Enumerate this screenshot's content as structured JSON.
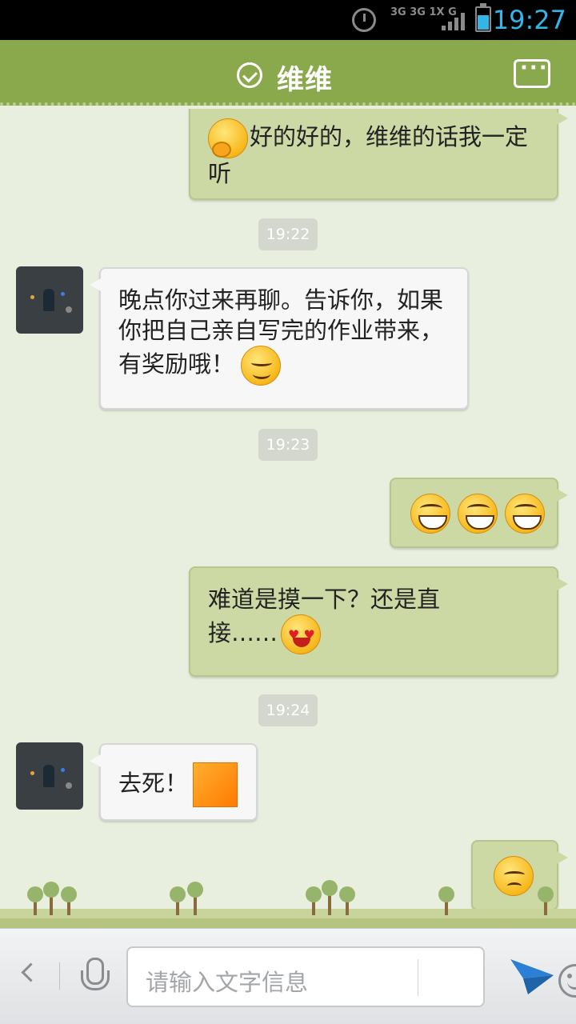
{
  "status_bar": {
    "time": "19:27",
    "network_label": "3G 3G 1X G",
    "alarm_icon": "alarm-icon",
    "signal_icon": "signal-bars-icon",
    "battery_icon": "battery-icon",
    "accent_color": "#33b5e5"
  },
  "header": {
    "title": "维维",
    "verified_icon": "check-circle-icon",
    "menu_icon": "more-dots-icon",
    "background_color": "#8aa94c"
  },
  "messages": [
    {
      "side": "me",
      "text": "好的好的，维维的话我一定听",
      "emoji": [
        "shy"
      ]
    },
    {
      "type": "time",
      "text": "19:22"
    },
    {
      "side": "them",
      "text": "晚点你过来再聊。告诉你，如果你把自己亲自写完的作业带来，有奖励哦！",
      "emoji": [
        "smile"
      ]
    },
    {
      "type": "time",
      "text": "19:23"
    },
    {
      "side": "me",
      "text": "",
      "emoji": [
        "grin",
        "grin",
        "grin"
      ]
    },
    {
      "side": "me",
      "text": "难道是摸一下？还是直接……",
      "emoji": [
        "heart"
      ]
    },
    {
      "type": "time",
      "text": "19:24"
    },
    {
      "side": "them",
      "text": "去死！",
      "emoji": [
        "orange-square"
      ]
    },
    {
      "side": "me",
      "text": "",
      "emoji": [
        "blush"
      ]
    }
  ],
  "input": {
    "placeholder": "请输入文字信息",
    "back_icon": "chevron-left-icon",
    "mic_icon": "microphone-icon",
    "emoji_icon": "smiley-icon",
    "send_icon": "send-plane-icon",
    "send_color": "#2b7fd4"
  }
}
